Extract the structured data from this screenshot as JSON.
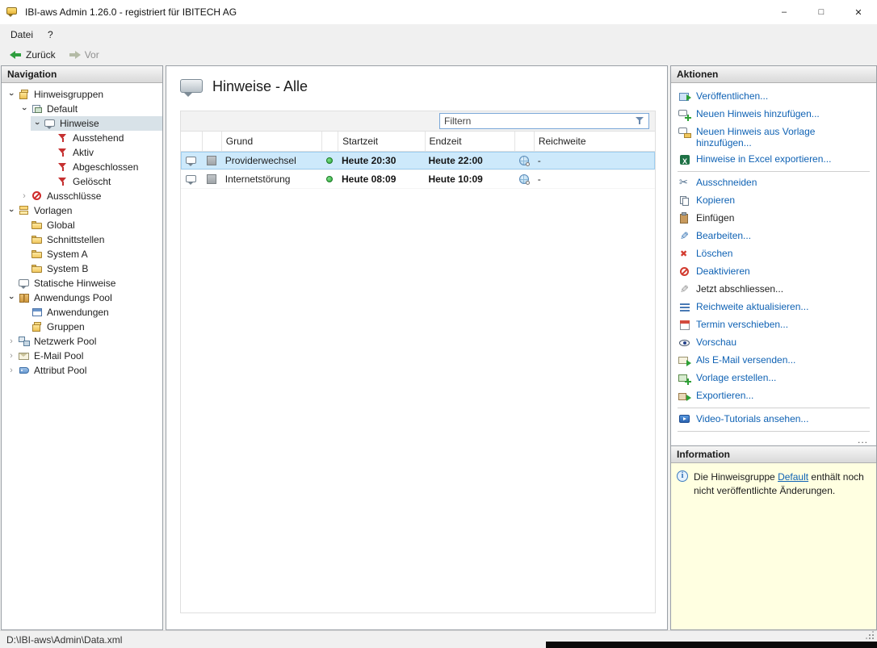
{
  "window": {
    "title": "IBI-aws Admin 1.26.0 - registriert für IBITECH AG",
    "minimize": "–",
    "maximize": "□",
    "close": "✕"
  },
  "menubar": {
    "items": [
      {
        "label": "Datei"
      },
      {
        "label": "?"
      }
    ]
  },
  "toolbar": {
    "back_label": "Zurück",
    "forward_label": "Vor"
  },
  "navigation": {
    "header": "Navigation",
    "tree": [
      {
        "label": "Hinweisgruppen",
        "level": 0,
        "chevron": "down",
        "icon": "group-icon"
      },
      {
        "label": "Default",
        "level": 1,
        "chevron": "down",
        "icon": "default-group-icon"
      },
      {
        "label": "Hinweise",
        "level": 2,
        "chevron": "down",
        "icon": "speech-bubble-icon",
        "selected": true
      },
      {
        "label": "Ausstehend",
        "level": 3,
        "chevron": null,
        "icon": "filter-icon"
      },
      {
        "label": "Aktiv",
        "level": 3,
        "chevron": null,
        "icon": "filter-icon"
      },
      {
        "label": "Abgeschlossen",
        "level": 3,
        "chevron": null,
        "icon": "filter-icon"
      },
      {
        "label": "Gelöscht",
        "level": 3,
        "chevron": null,
        "icon": "filter-icon"
      },
      {
        "label": "Ausschlüsse",
        "level": 1,
        "chevron": "right",
        "icon": "block-icon"
      },
      {
        "label": "Vorlagen",
        "level": 0,
        "chevron": "down",
        "icon": "templates-icon"
      },
      {
        "label": "Global",
        "level": 1,
        "chevron": null,
        "icon": "folder-icon"
      },
      {
        "label": "Schnittstellen",
        "level": 1,
        "chevron": null,
        "icon": "folder-icon"
      },
      {
        "label": "System A",
        "level": 1,
        "chevron": null,
        "icon": "folder-icon"
      },
      {
        "label": "System B",
        "level": 1,
        "chevron": null,
        "icon": "folder-icon"
      },
      {
        "label": "Statische Hinweise",
        "level": 0,
        "chevron": null,
        "icon": "speech-bubble-icon"
      },
      {
        "label": "Anwendungs Pool",
        "level": 0,
        "chevron": "down",
        "icon": "package-icon"
      },
      {
        "label": "Anwendungen",
        "level": 1,
        "chevron": null,
        "icon": "app-window-icon"
      },
      {
        "label": "Gruppen",
        "level": 1,
        "chevron": null,
        "icon": "group-icon"
      },
      {
        "label": "Netzwerk Pool",
        "level": 0,
        "chevron": "right",
        "icon": "network-icon"
      },
      {
        "label": "E-Mail Pool",
        "level": 0,
        "chevron": "right",
        "icon": "mail-icon"
      },
      {
        "label": "Attribut Pool",
        "level": 0,
        "chevron": "right",
        "icon": "tag-icon"
      }
    ]
  },
  "content": {
    "title": "Hinweise - Alle",
    "filter_placeholder": "Filtern",
    "table": {
      "columns": [
        "",
        "",
        "Grund",
        "",
        "Startzeit",
        "Endzeit",
        "",
        "Reichweite"
      ],
      "rows": [
        {
          "grund": "Providerwechsel",
          "startzeit": "Heute 20:30",
          "endzeit": "Heute 22:00",
          "reichweite": "-",
          "selected": true
        },
        {
          "grund": "Internetstörung",
          "startzeit": "Heute 08:09",
          "endzeit": "Heute 10:09",
          "reichweite": "-",
          "selected": false
        }
      ]
    }
  },
  "actions": {
    "header": "Aktionen",
    "more": "...",
    "items": [
      {
        "label": "Veröffentlichen...",
        "icon": "publish-icon",
        "style": "link"
      },
      {
        "label": "Neuen Hinweis hinzufügen...",
        "icon": "add-note-icon",
        "style": "link"
      },
      {
        "label": "Neuen Hinweis aus Vorlage hinzufügen...",
        "icon": "add-from-template-icon",
        "style": "link"
      },
      {
        "label": "Hinweise in Excel exportieren...",
        "icon": "excel-icon",
        "style": "link",
        "divider_after": true
      },
      {
        "label": "Ausschneiden",
        "icon": "cut-icon",
        "style": "link"
      },
      {
        "label": "Kopieren",
        "icon": "copy-icon",
        "style": "link"
      },
      {
        "label": "Einfügen",
        "icon": "paste-icon",
        "style": "plain"
      },
      {
        "label": "Bearbeiten...",
        "icon": "edit-icon",
        "style": "link"
      },
      {
        "label": "Löschen",
        "icon": "delete-icon",
        "style": "link"
      },
      {
        "label": "Deaktivieren",
        "icon": "deactivate-icon",
        "style": "link"
      },
      {
        "label": "Jetzt abschliessen...",
        "icon": "finish-icon",
        "style": "plain"
      },
      {
        "label": "Reichweite aktualisieren...",
        "icon": "refresh-icon",
        "style": "link"
      },
      {
        "label": "Termin verschieben...",
        "icon": "calendar-icon",
        "style": "link"
      },
      {
        "label": "Vorschau",
        "icon": "preview-icon",
        "style": "link"
      },
      {
        "label": "Als E-Mail versenden...",
        "icon": "send-mail-icon",
        "style": "link"
      },
      {
        "label": "Vorlage erstellen...",
        "icon": "create-template-icon",
        "style": "link"
      },
      {
        "label": "Exportieren...",
        "icon": "export-icon",
        "style": "link",
        "divider_after": true
      },
      {
        "label": "Video-Tutorials ansehen...",
        "icon": "video-icon",
        "style": "link",
        "divider_after": true
      }
    ]
  },
  "information": {
    "header": "Information",
    "text_before": "Die Hinweisgruppe ",
    "link": "Default",
    "text_after": " enthält noch nicht veröffentlichte Änderungen."
  },
  "statusbar": {
    "path": "D:\\IBI-aws\\Admin\\Data.xml"
  }
}
